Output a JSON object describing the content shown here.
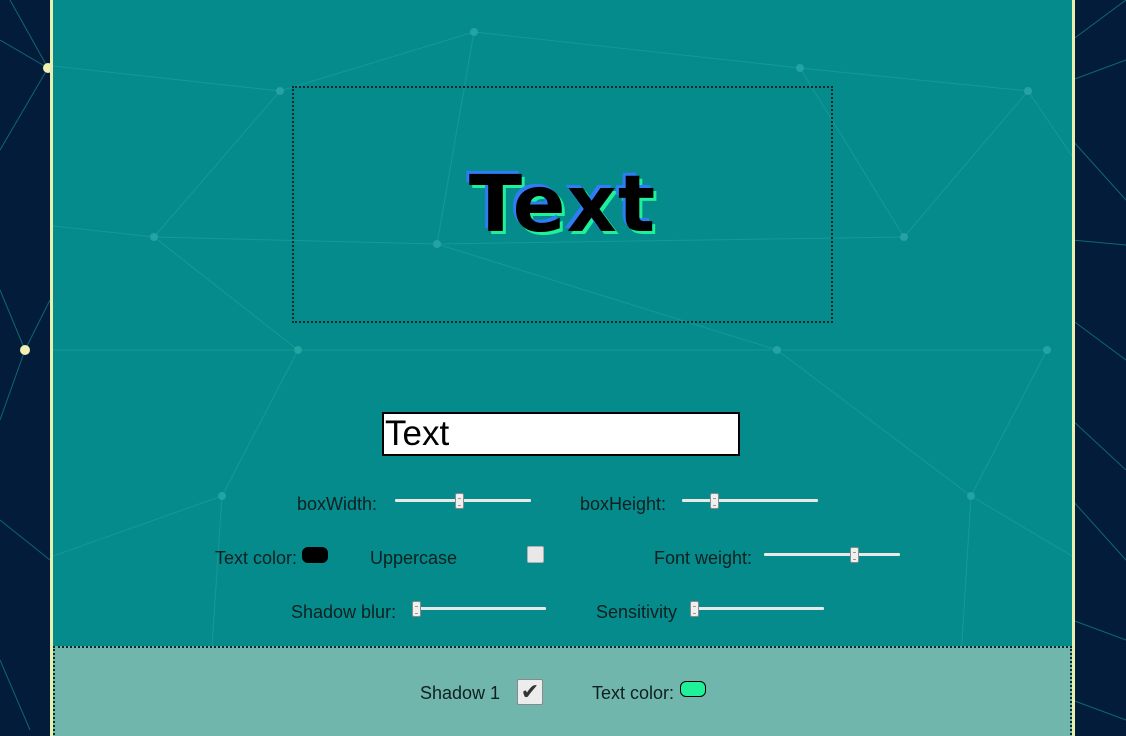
{
  "preview": {
    "text": "Text"
  },
  "input": {
    "value": "Text"
  },
  "controls": {
    "box_width": {
      "label": "boxWidth:",
      "fraction": 0.47
    },
    "box_height": {
      "label": "boxHeight:",
      "fraction": 0.22
    },
    "text_color": {
      "label": "Text color:",
      "color": "#000000"
    },
    "uppercase": {
      "label": "Uppercase",
      "checked": false
    },
    "font_weight": {
      "label": "Font weight:",
      "fraction": 0.68
    },
    "shadow_blur": {
      "label": "Shadow blur:",
      "fraction": 0.0
    },
    "sensitivity": {
      "label": "Sensitivity",
      "fraction": 0.0
    }
  },
  "shadow_section": {
    "shadow1": {
      "label": "Shadow 1",
      "checked": true,
      "check_glyph": "✔"
    },
    "text_color": {
      "label": "Text color:",
      "color": "#1ff09a"
    }
  },
  "colors": {
    "page_background": "#021c3a",
    "panel_background": "#058b8c",
    "panel_border": "#e9efb0",
    "shadow_section_background": "#70b6ac",
    "preview_shadow_blue": "#2f7cf6",
    "preview_shadow_green": "#1ff09a"
  }
}
